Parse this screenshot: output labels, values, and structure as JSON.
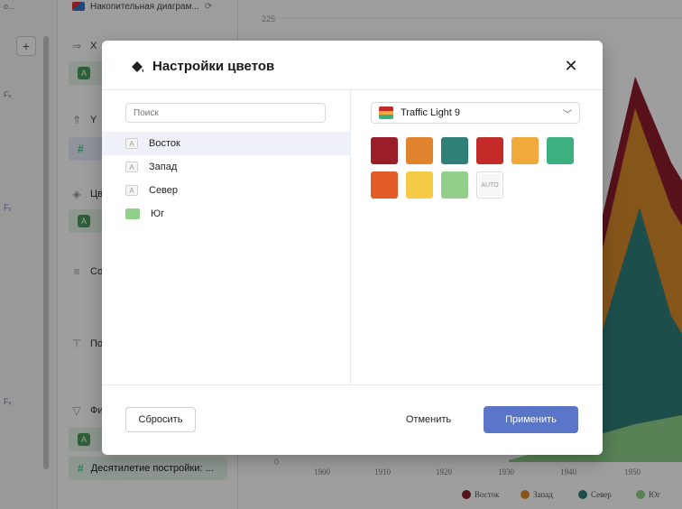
{
  "background": {
    "chart_title_chip": "Накопительная диаграм...",
    "left_tiny_labels": [
      "о...",
      "Fₓ",
      "Fₓ",
      "Fₓ"
    ],
    "sections": [
      {
        "icon": "arrow-right-icon",
        "label": "X"
      },
      {
        "icon": "arrow-up-icon",
        "label": "Y"
      },
      {
        "icon": "paint-bucket-icon",
        "label": "Цв"
      },
      {
        "icon": "sort-icon",
        "label": "Со"
      },
      {
        "icon": "label-icon",
        "label": "По"
      },
      {
        "icon": "filter-icon",
        "label": "Фи"
      }
    ],
    "bottom_chip": "Десятилетие постройки: ...",
    "chart": {
      "y_top_tick": "225",
      "y_bottom_tick": "0",
      "x_ticks": [
        "1900",
        "1910",
        "1920",
        "1930",
        "1940",
        "1950"
      ],
      "legend": [
        {
          "name": "Восток",
          "color": "#8b1c2c"
        },
        {
          "name": "Запад",
          "color": "#d98a2b"
        },
        {
          "name": "Север",
          "color": "#2f7f7a"
        },
        {
          "name": "Юг",
          "color": "#8fd08a"
        }
      ]
    }
  },
  "dialog": {
    "title": "Настройки цветов",
    "close_label": "✕",
    "search_placeholder": "Поиск",
    "dimensions": [
      {
        "type_badge": "A",
        "label": "Восток",
        "selected": true
      },
      {
        "type_badge": "A",
        "label": "Запад",
        "selected": false
      },
      {
        "type_badge": "A",
        "label": "Север",
        "selected": false
      },
      {
        "type_badge": "",
        "label": "Юг",
        "selected": false,
        "color": "#8fd08a"
      }
    ],
    "palette": {
      "name": "Traffic Light 9",
      "colors": [
        "#9b1d2a",
        "#e0842d",
        "#2e8078",
        "#c22b27",
        "#f2a93b",
        "#3db07f",
        "#e35b25",
        "#f6cb45",
        "#92cf8a"
      ],
      "auto_label": "AUTO"
    },
    "buttons": {
      "reset": "Сбросить",
      "cancel": "Отменить",
      "apply": "Применить"
    }
  }
}
